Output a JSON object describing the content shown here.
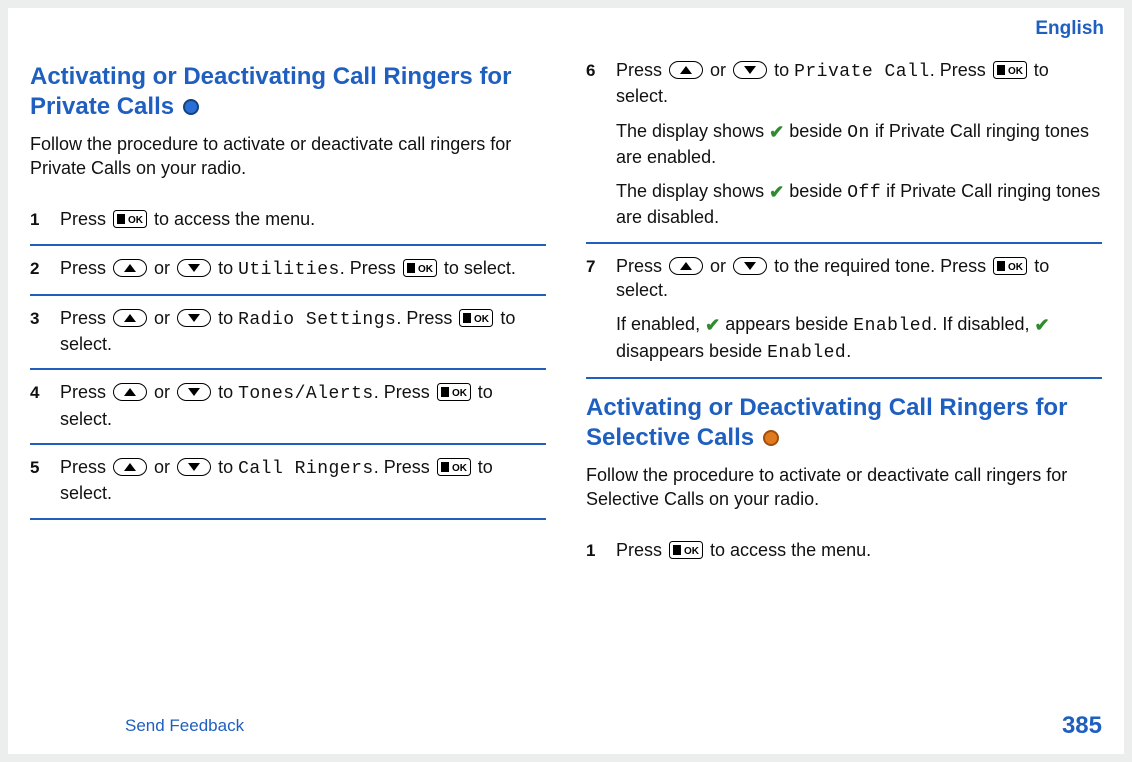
{
  "header": {
    "lang": "English"
  },
  "footer": {
    "feedback": "Send Feedback",
    "page": "385"
  },
  "section1": {
    "title": "Activating or Deactivating Call Ringers for Private Calls",
    "intro": "Follow the procedure to activate or deactivate call ringers for Private Calls on your radio.",
    "steps": {
      "s1": {
        "num": "1",
        "a": "Press ",
        "b": " to access the menu."
      },
      "s2": {
        "num": "2",
        "a": "Press ",
        "or": " or ",
        "to": " to ",
        "menu": "Utilities",
        "p": ". Press ",
        "sel": " to select."
      },
      "s3": {
        "num": "3",
        "a": "Press ",
        "or": " or ",
        "to": " to ",
        "menu": "Radio Settings",
        "p": ". Press ",
        "sel": " to select."
      },
      "s4": {
        "num": "4",
        "a": "Press ",
        "or": " or ",
        "to": " to ",
        "menu": "Tones/Alerts",
        "p": ". Press ",
        "sel": " to select."
      },
      "s5": {
        "num": "5",
        "a": "Press ",
        "or": " or ",
        "to": " to ",
        "menu": "Call Ringers",
        "p": ". Press ",
        "sel": " to select."
      },
      "s6": {
        "num": "6",
        "a": "Press ",
        "or": " or ",
        "to": " to ",
        "menu": "Private Call",
        "p": ". Press ",
        "sel": " to select.",
        "l2a": "The display shows ",
        "l2b": " beside ",
        "l2on": "On",
        "l2c": " if Private Call ringing tones are enabled.",
        "l3a": "The display shows ",
        "l3b": " beside ",
        "l3off": "Off",
        "l3c": " if Private Call ringing tones are disabled."
      },
      "s7": {
        "num": "7",
        "a": "Press ",
        "or": " or ",
        "to": " to the required tone. Press ",
        "sel": " to select.",
        "l2a": "If enabled, ",
        "l2b": " appears beside ",
        "l2m": "Enabled",
        "l2c": ". If disabled, ",
        "l2d": " disappears beside ",
        "l2m2": "Enabled",
        "l2e": "."
      }
    }
  },
  "section2": {
    "title": "Activating or Deactivating Call Ringers for Selective Calls",
    "intro": "Follow the procedure to activate or deactivate call ringers for Selective Calls on your radio.",
    "steps": {
      "s1": {
        "num": "1",
        "a": "Press ",
        "b": " to access the menu."
      }
    }
  }
}
